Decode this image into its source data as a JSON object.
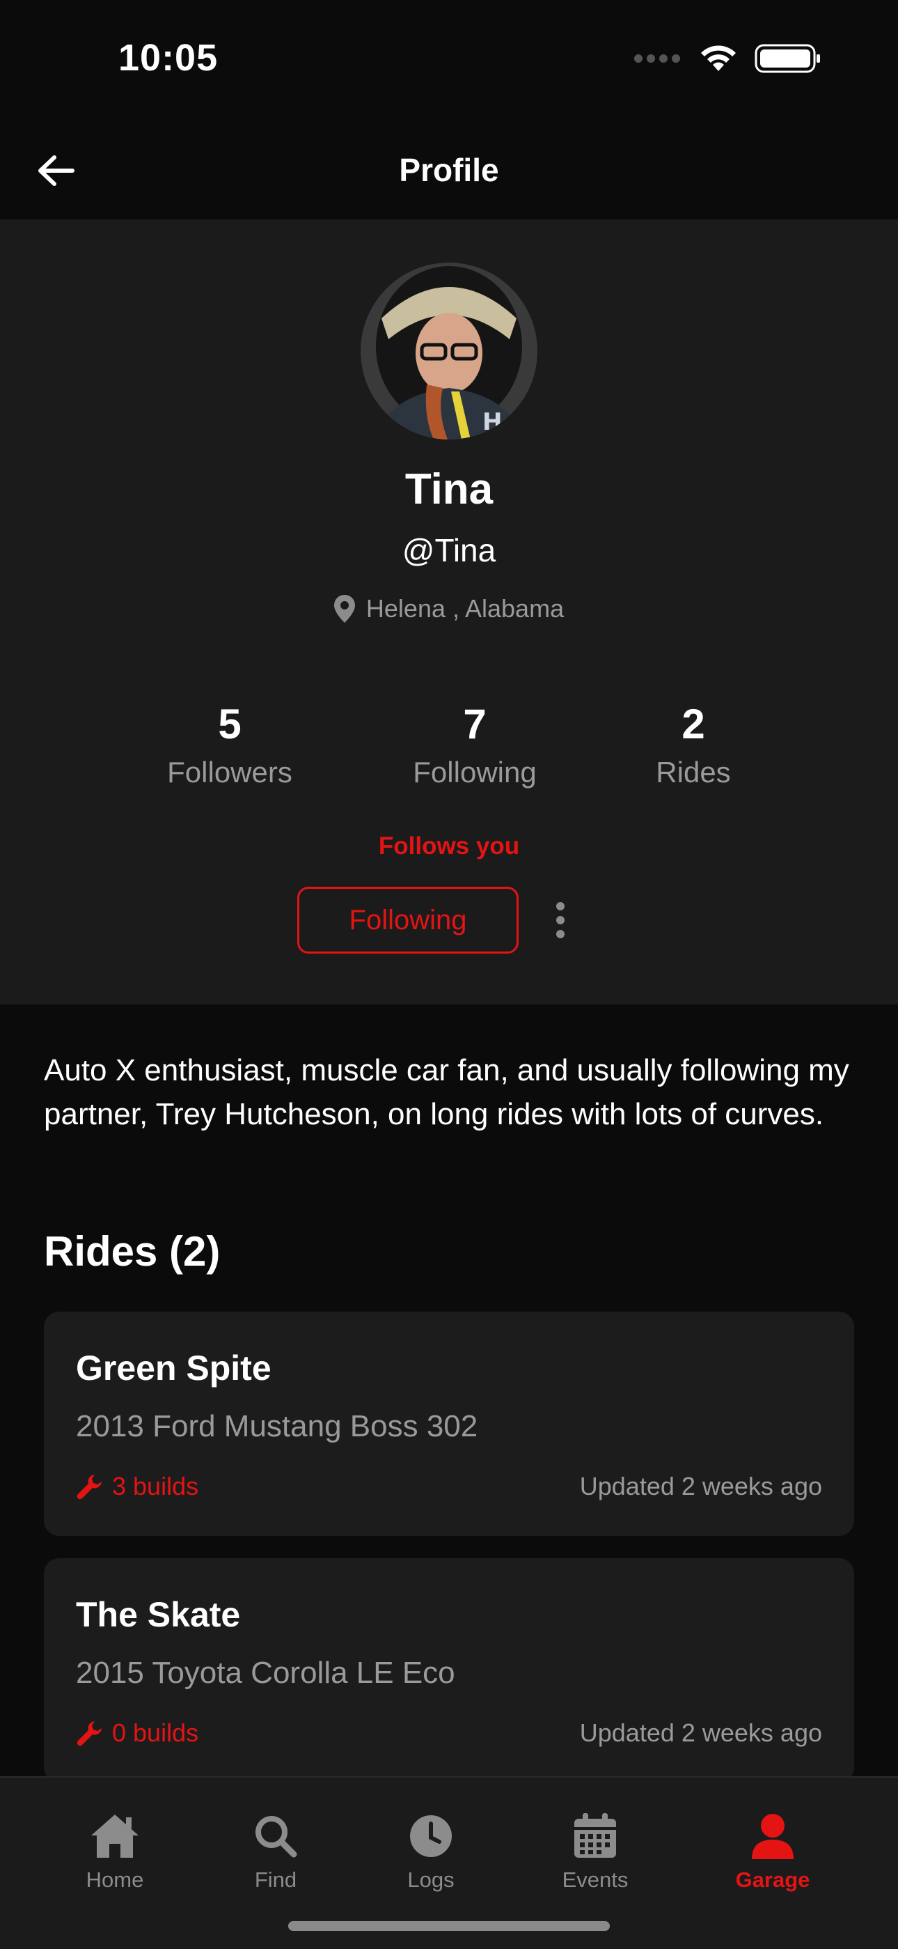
{
  "status_bar": {
    "time": "10:05"
  },
  "header": {
    "title": "Profile"
  },
  "profile": {
    "name": "Tina",
    "handle": "@Tina",
    "location": "Helena , Alabama",
    "stats": [
      {
        "value": "5",
        "label": "Followers"
      },
      {
        "value": "7",
        "label": "Following"
      },
      {
        "value": "2",
        "label": "Rides"
      }
    ],
    "follows_you": "Follows you",
    "follow_button": "Following"
  },
  "bio": "Auto X enthusiast, muscle car fan, and usually following my partner, Trey Hutcheson, on long rides with lots of curves.",
  "rides": {
    "heading": "Rides (2)",
    "items": [
      {
        "name": "Green Spite",
        "model": "2013 Ford Mustang Boss 302",
        "builds": "3 builds",
        "updated": "Updated 2 weeks ago"
      },
      {
        "name": "The Skate",
        "model": "2015 Toyota Corolla LE Eco",
        "builds": "0 builds",
        "updated": "Updated 2 weeks ago"
      }
    ]
  },
  "tabs": [
    {
      "label": "Home",
      "icon": "home-icon",
      "active": false
    },
    {
      "label": "Find",
      "icon": "search-icon",
      "active": false
    },
    {
      "label": "Logs",
      "icon": "clock-icon",
      "active": false
    },
    {
      "label": "Events",
      "icon": "calendar-icon",
      "active": false
    },
    {
      "label": "Garage",
      "icon": "person-icon",
      "active": true
    }
  ],
  "colors": {
    "accent": "#e41414",
    "background": "#0b0b0b",
    "panel": "#1b1b1b",
    "card": "#1c1c1c",
    "muted_text": "#9a9a9a"
  }
}
